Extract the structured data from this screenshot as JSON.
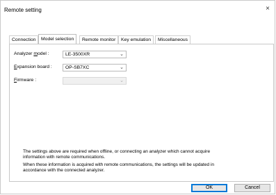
{
  "window": {
    "title": "Remote setting",
    "close_symbol": "×"
  },
  "tabs": [
    {
      "label": "Connection"
    },
    {
      "label": "Model selection"
    },
    {
      "label": "Remote monitor"
    },
    {
      "label": "Key emulation"
    },
    {
      "label": "Miscellaneous"
    }
  ],
  "form": {
    "analyzer_model": {
      "label_pre": "Analyzer ",
      "label_ul": "m",
      "label_post": "odel :",
      "value": "LE-3500XR"
    },
    "expansion_board": {
      "label_pre": "",
      "label_ul": "E",
      "label_post": "xpansion board :",
      "value": "OP-SB7XC"
    },
    "firmware": {
      "label_pre": "",
      "label_ul": "F",
      "label_post": "irmware :",
      "value": ""
    }
  },
  "notes": {
    "line1": "The settings above are required when offline, or connecting an analyzer which cannot acquire",
    "line2": "information with remote communications.",
    "line3": "When these information is acquired with remote communications, the settings will be updated in",
    "line4": "accordance with the connected analyzer."
  },
  "buttons": {
    "ok": "OK",
    "cancel": "Cancel"
  },
  "icons": {
    "close": "close-icon",
    "dropdown": "chevron-down-icon"
  },
  "colors": {
    "default_button_border": "#0078d7",
    "disabled_field": "#f0f0f0"
  }
}
